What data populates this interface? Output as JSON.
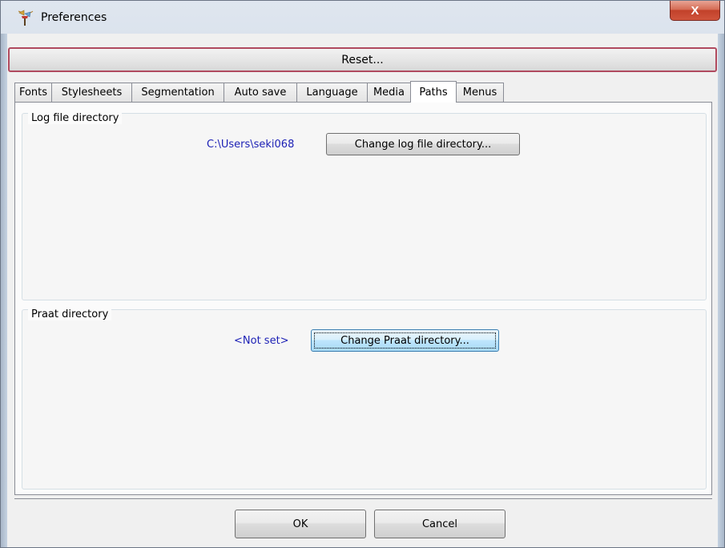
{
  "window": {
    "title": "Preferences",
    "close_label": "X",
    "icon": "praat-app-icon"
  },
  "toolbar": {
    "reset_label": "Reset..."
  },
  "tabs": [
    {
      "label": "Fonts",
      "active": false
    },
    {
      "label": "Stylesheets",
      "active": false
    },
    {
      "label": "Segmentation",
      "active": false
    },
    {
      "label": "Auto save",
      "active": false
    },
    {
      "label": "Language",
      "active": false
    },
    {
      "label": "Media",
      "active": false
    },
    {
      "label": "Paths",
      "active": true
    },
    {
      "label": "Menus",
      "active": false
    }
  ],
  "paths": {
    "log_group_title": "Log file directory",
    "log_path": "C:\\Users\\seki068",
    "log_button": "Change log file directory...",
    "praat_group_title": "Praat directory",
    "praat_path": "<Not set>",
    "praat_button": "Change Praat directory..."
  },
  "footer": {
    "ok_label": "OK",
    "cancel_label": "Cancel"
  },
  "colors": {
    "path_text": "#1b1fb5",
    "reset_border": "#b04a5f",
    "close_button": "#c2412a"
  }
}
